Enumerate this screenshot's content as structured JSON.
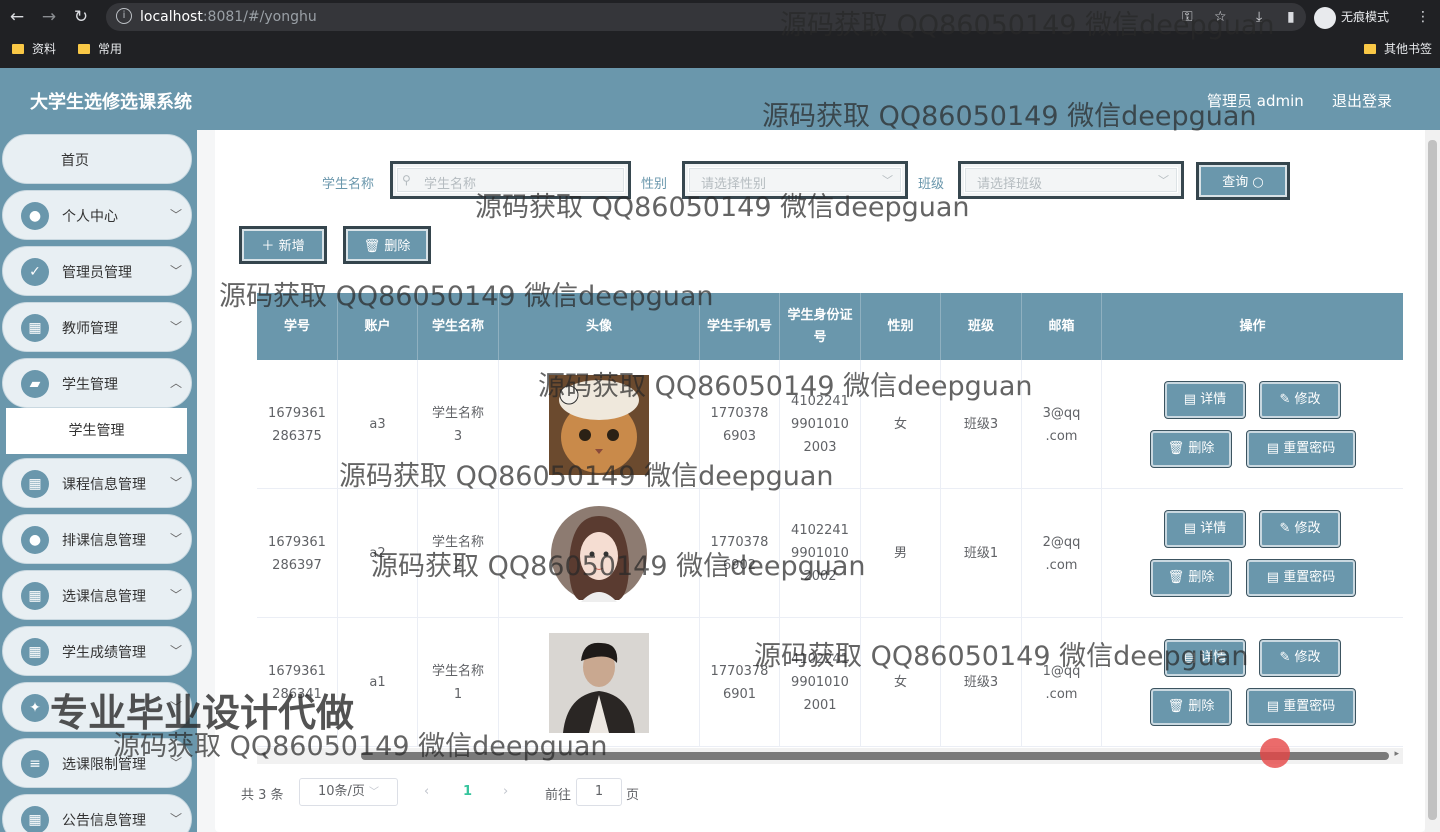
{
  "browser": {
    "url_host": "localhost",
    "url_rest": ":8081/#/yonghu",
    "incognito_label": "无痕模式",
    "bookmarks": [
      "资料",
      "常用"
    ],
    "other_bookmarks": "其他书签"
  },
  "header": {
    "title": "大学生选修选课系统",
    "admin_label": "管理员 admin",
    "logout_label": "退出登录"
  },
  "sidebar": {
    "items": [
      {
        "label": "首页",
        "icon": "home"
      },
      {
        "label": "个人中心",
        "icon": "user-icon"
      },
      {
        "label": "管理员管理",
        "icon": "clipboard-icon"
      },
      {
        "label": "教师管理",
        "icon": "grid-icon"
      },
      {
        "label": "学生管理",
        "icon": "wallet-icon"
      },
      {
        "label": "课程信息管理",
        "icon": "grid-icon"
      },
      {
        "label": "排课信息管理",
        "icon": "user-icon"
      },
      {
        "label": "选课信息管理",
        "icon": "grid-icon"
      },
      {
        "label": "学生成绩管理",
        "icon": "grid-icon"
      },
      {
        "label": "",
        "icon": "bulb-icon"
      },
      {
        "label": "选课限制管理",
        "icon": "list-icon"
      },
      {
        "label": "公告信息管理",
        "icon": "grid-icon"
      }
    ],
    "active_sub": "学生管理"
  },
  "search": {
    "name_label": "学生名称",
    "name_placeholder": "学生名称",
    "gender_label": "性别",
    "gender_placeholder": "请选择性别",
    "class_label": "班级",
    "class_placeholder": "请选择班级",
    "query_button": "查询"
  },
  "actions": {
    "add": "新增",
    "delete": "删除"
  },
  "table": {
    "columns": [
      "学号",
      "账户",
      "学生名称",
      "头像",
      "学生手机号",
      "学生身份证号",
      "性别",
      "班级",
      "邮箱",
      "操作"
    ],
    "rows": [
      {
        "id": "1679361286375",
        "account": "a3",
        "name": "学生名称3",
        "avatar": "cat",
        "phone": "17703786903",
        "idcard": "410224199010102003",
        "gender": "女",
        "class": "班级3",
        "email": "3@qq.com"
      },
      {
        "id": "1679361286397",
        "account": "a2",
        "name": "学生名称2",
        "avatar": "girl",
        "phone": "17703786902",
        "idcard": "410224199010102002",
        "gender": "男",
        "class": "班级1",
        "email": "2@qq.com"
      },
      {
        "id": "1679361286341",
        "account": "a1",
        "name": "学生名称1",
        "avatar": "man",
        "phone": "17703786901",
        "idcard": "410224199010102001",
        "gender": "女",
        "class": "班级3",
        "email": "1@qq.com"
      }
    ],
    "row_buttons": {
      "detail": "详情",
      "edit": "修改",
      "delete": "删除",
      "reset": "重置密码"
    }
  },
  "pagination": {
    "total": "共 3 条",
    "page_size": "10条/页",
    "current": "1",
    "goto_label": "前往",
    "goto_value": "1",
    "page_unit": "页"
  },
  "watermark": {
    "text": "源码获取 QQ86050149 微信deepguan",
    "promo": "专业毕业设计代做"
  },
  "colors": {
    "primary": "#6a97ac",
    "active_page": "#37c59d"
  }
}
